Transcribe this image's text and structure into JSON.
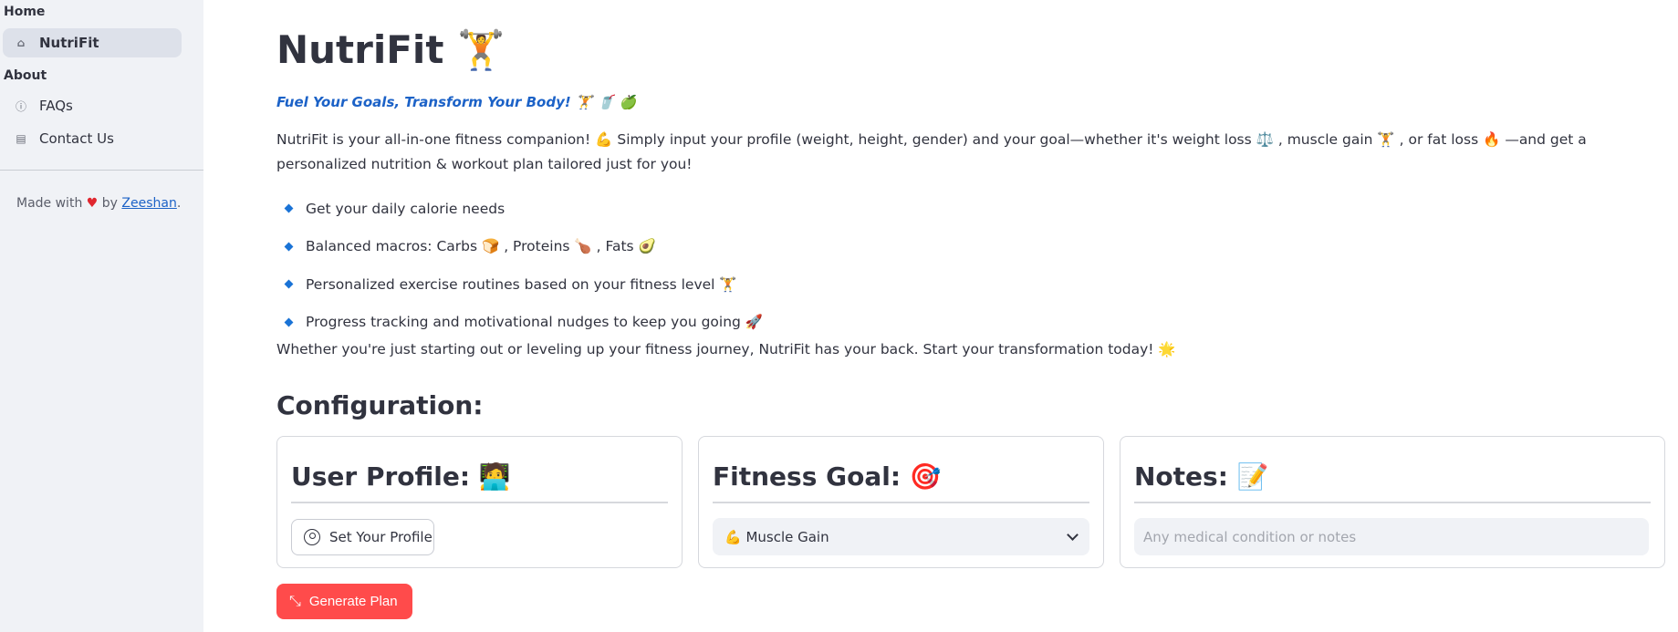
{
  "sidebar": {
    "home_header": "Home",
    "nav_active": "NutriFit",
    "about_header": "About",
    "faqs": "FAQs",
    "contact": "Contact Us",
    "footer_prefix": "Made with",
    "footer_by": "by",
    "footer_author": "Zeeshan",
    "footer_suffix": "."
  },
  "main": {
    "title": "NutriFit 🏋️",
    "tagline": "Fuel Your Goals, Transform Your Body! 🏋️ 🥤 🍏",
    "intro": "NutriFit is your all-in-one fitness companion! 💪 Simply input your profile (weight, height, gender) and your goal—whether it's weight loss ⚖️ , muscle gain 🏋️ , or fat loss 🔥 —and get a personalized nutrition & workout plan tailored just for you!",
    "bullets": [
      "Get your daily calorie needs",
      "Balanced macros: Carbs 🍞 , Proteins 🍗 , Fats 🥑",
      "Personalized exercise routines based on your fitness level 🏋️",
      "Progress tracking and motivational nudges to keep you going 🚀"
    ],
    "outro": "Whether you're just starting out or leveling up your fitness journey, NutriFit has your back. Start your transformation today! 🌟",
    "config_heading": "Configuration:"
  },
  "cards": {
    "profile_title": "User Profile: 🧑‍💻",
    "profile_button": "Set Your Profile",
    "goal_title": "Fitness Goal: 🎯",
    "goal_selected": "💪 Muscle Gain",
    "notes_title": "Notes: 📝",
    "notes_placeholder": "Any medical condition or notes"
  },
  "generate_button": "Generate Plan",
  "colors": {
    "accent": "#ff4b4b",
    "link": "#1c62c7",
    "sidebar_bg": "#f0f2f6"
  }
}
